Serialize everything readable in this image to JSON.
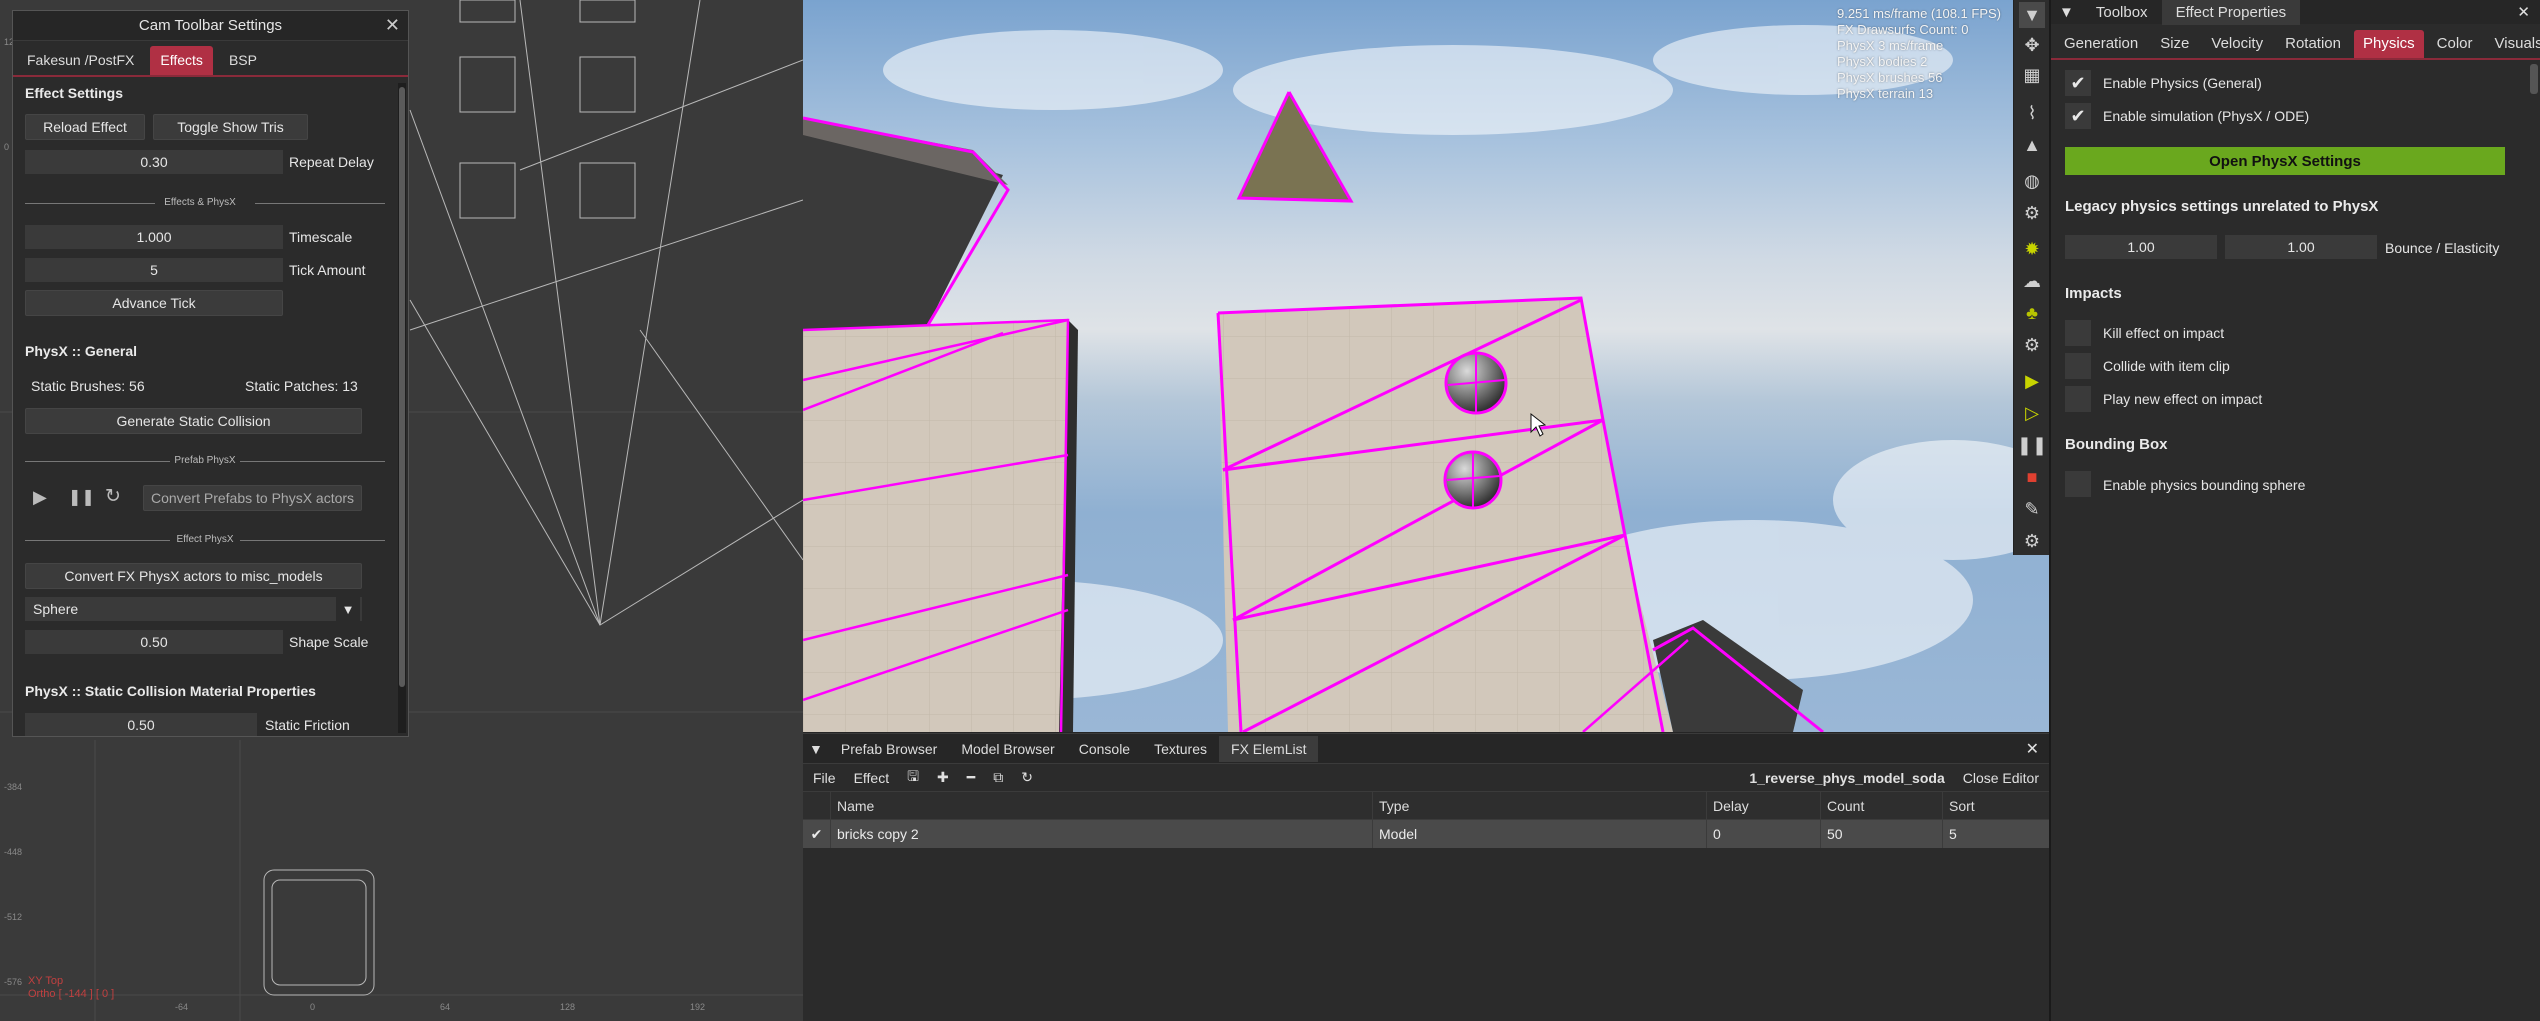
{
  "colors": {
    "accent": "#b03044",
    "physx_green": "#6aa81e",
    "outline_magenta": "#ff00ff"
  },
  "cam_window": {
    "title": "Cam Toolbar Settings",
    "tabs": [
      "Fakesun /PostFX",
      "Effects",
      "BSP"
    ],
    "effect_settings": {
      "heading": "Effect Settings",
      "reload_button": "Reload Effect",
      "toggle_tris_button": "Toggle Show Tris",
      "repeat_delay_value": "0.30",
      "repeat_delay_label": "Repeat Delay"
    },
    "effects_physx": {
      "divider": "Effects & PhysX",
      "timescale_value": "1.000",
      "timescale_label": "Timescale",
      "tick_amount_value": "5",
      "tick_amount_label": "Tick Amount",
      "advance_tick_button": "Advance Tick"
    },
    "physx_general": {
      "heading": "PhysX :: General",
      "static_brushes": "Static Brushes: 56",
      "static_patches": "Static Patches: 13",
      "generate_button": "Generate Static Collision"
    },
    "prefab_physx": {
      "divider": "Prefab PhysX",
      "convert_button": "Convert Prefabs to PhysX actors"
    },
    "effect_physx": {
      "divider": "Effect PhysX",
      "convert_button": "Convert FX PhysX actors to misc_models",
      "shape_value": "Sphere",
      "shape_scale_value": "0.50",
      "shape_scale_label": "Shape Scale"
    },
    "static_material": {
      "heading": "PhysX :: Static Collision Material Properties",
      "static_friction_value": "0.50",
      "static_friction_label": "Static Friction"
    }
  },
  "viewport_stats": [
    "9.251 ms/frame (108.1 FPS)",
    "FX Drawsurfs Count: 0",
    "PhysX 3 ms/frame",
    "PhysX bodies 2",
    "PhysX brushes 56",
    "PhysX terrain 13"
  ],
  "ortho_readout": {
    "line1": "XY Top",
    "line2": "Ortho [ -144 ] [ 0 ]"
  },
  "viewport_toolbar_icons": [
    "filter-icon",
    "move-icon",
    "grid-icon",
    "paperclip-icon",
    "terrain-icon",
    "globe-icon",
    "settings-icon",
    "sun-icon",
    "cloud-icon",
    "tree-icon",
    "settings-icon",
    "play-icon",
    "play-outline-icon",
    "pause-icon",
    "stop-icon",
    "edit-icon",
    "settings-icon"
  ],
  "bottom_panel": {
    "tabs": [
      "Prefab Browser",
      "Model Browser",
      "Console",
      "Textures",
      "FX ElemList"
    ],
    "menu": [
      "File",
      "Effect"
    ],
    "effect_name": "1_reverse_phys_model_soda",
    "close_editor": "Close Editor",
    "columns": [
      "Name",
      "Type",
      "Delay",
      "Count",
      "Sort"
    ],
    "rows": [
      {
        "name": "bricks copy 2",
        "type": "Model",
        "delay": "0",
        "count": "50",
        "sort": "5"
      }
    ]
  },
  "toolbox": {
    "tabs": [
      "Toolbox",
      "Effect Properties"
    ],
    "subtabs": [
      "Generation",
      "Size",
      "Velocity",
      "Rotation",
      "Physics",
      "Color",
      "Visuals"
    ],
    "enable_physics_general": "Enable Physics (General)",
    "enable_simulation": "Enable simulation (PhysX / ODE)",
    "open_physx_button": "Open PhysX Settings",
    "legacy_heading": "Legacy physics settings unrelated to PhysX",
    "bounce_min": "1.00",
    "bounce_max": "1.00",
    "bounce_label": "Bounce / Elasticity",
    "impacts_heading": "Impacts",
    "kill_effect": "Kill effect on impact",
    "collide_clip": "Collide with item clip",
    "play_new_effect": "Play new effect on impact",
    "bbox_heading": "Bounding Box",
    "enable_bsphere": "Enable physics bounding sphere"
  }
}
